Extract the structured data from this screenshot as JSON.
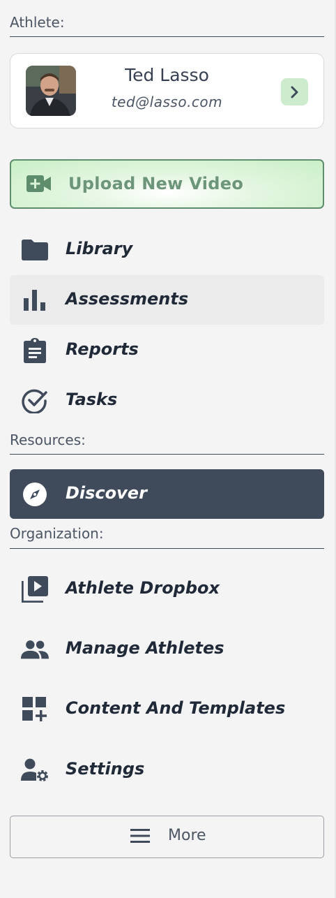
{
  "sections": {
    "athlete": "Athlete:",
    "resources": "Resources:",
    "organization": "Organization:"
  },
  "athlete": {
    "name": "Ted Lasso",
    "email": "ted@lasso.com"
  },
  "upload": {
    "label": "Upload New Video"
  },
  "nav": {
    "library": "Library",
    "assessments": "Assessments",
    "reports": "Reports",
    "tasks": "Tasks",
    "discover": "Discover",
    "athlete_dropbox": "Athlete Dropbox",
    "manage_athletes": "Manage Athletes",
    "content_templates": "Content And Templates",
    "settings": "Settings"
  },
  "more": {
    "label": "More"
  },
  "colors": {
    "accent_dark": "#3f4a5a",
    "upload_green": "#c9efc6",
    "upload_text": "#6d9579",
    "background": "#f4f4f4"
  },
  "icons": {
    "upload": "video-plus-icon",
    "library": "folder-icon",
    "assessments": "bar-chart-icon",
    "reports": "clipboard-icon",
    "tasks": "check-circle-icon",
    "discover": "compass-icon",
    "athlete_dropbox": "video-library-icon",
    "manage_athletes": "people-icon",
    "content_templates": "dashboard-add-icon",
    "settings": "user-gear-icon",
    "more": "menu-icon",
    "athlete_go": "chevron-right-icon"
  }
}
